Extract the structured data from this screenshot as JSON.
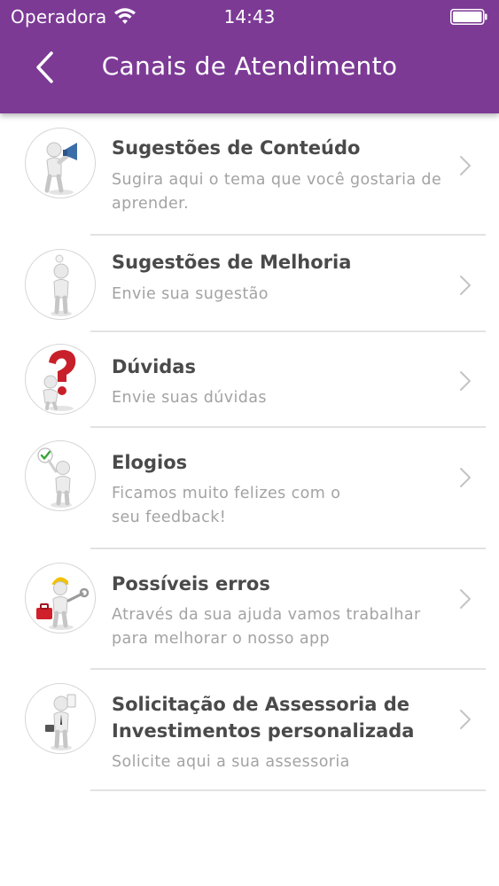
{
  "status_bar": {
    "carrier": "Operadora",
    "time": "14:43",
    "wifi_icon": "wifi-icon",
    "battery_icon": "battery-icon"
  },
  "nav": {
    "title": "Canais de Atendimento",
    "back_icon": "chevron-left-icon"
  },
  "colors": {
    "header": "#7c3a95",
    "title_text": "#4a4a4a",
    "subtitle_text": "#a3a3a3",
    "divider": "#e2e2e2",
    "question_mark": "#c8202a",
    "megaphone": "#3b6ea8",
    "toolbox": "#d0202a",
    "check": "#3aa43a",
    "helmet": "#f2c200"
  },
  "items": [
    {
      "title": "Sugestões de Conteúdo",
      "subtitle": "Sugira aqui o tema que você gostaria de aprender.",
      "icon": "megaphone-figure-icon"
    },
    {
      "title": "Sugestões de Melhoria",
      "subtitle": "Envie sua sugestão",
      "icon": "lightbulb-figure-icon"
    },
    {
      "title": "Dúvidas",
      "subtitle": "Envie suas dúvidas",
      "icon": "question-mark-figure-icon"
    },
    {
      "title": "Elogios",
      "subtitle": "Ficamos muito felizes com o seu feedback!",
      "icon": "checkmark-figure-icon"
    },
    {
      "title": "Possíveis erros",
      "subtitle": "Através da sua ajuda vamos trabalhar para melhorar o nosso app",
      "icon": "repair-figure-icon"
    },
    {
      "title": "Solicitação de Assessoria de Investimentos personalizada",
      "subtitle": "Solicite aqui a sua assessoria",
      "icon": "briefcase-figure-icon"
    }
  ]
}
